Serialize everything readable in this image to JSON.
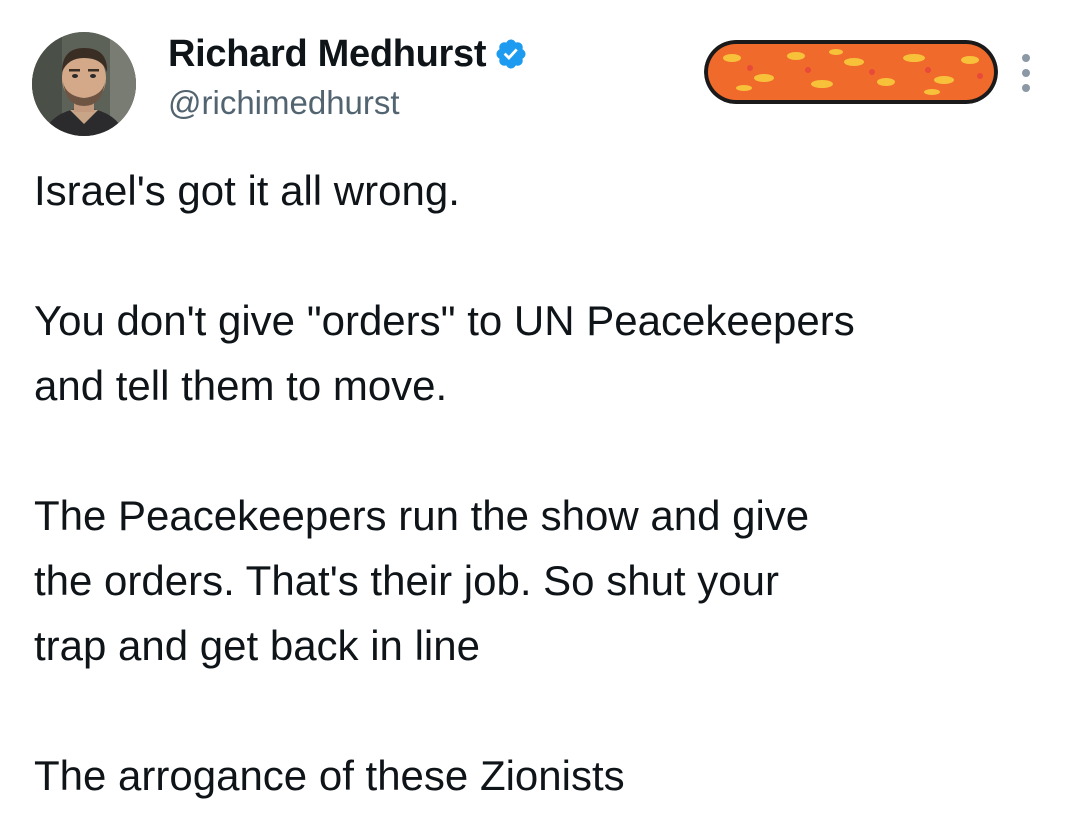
{
  "tweet": {
    "author": {
      "display_name": "Richard Medhurst",
      "handle": "@richimedhurst",
      "verified": true,
      "avatar_icon": "profile-photo"
    },
    "redacted_button_icon": "redacted-scribble",
    "more_icon": "vertical-ellipsis-icon",
    "paragraphs": [
      "Israel's got it all wrong.",
      "You don't give \"orders\" to UN Peacekeepers\nand tell them to move.",
      "The Peacekeepers run the show and give\nthe orders. That's their job. So shut your\ntrap and get back in line",
      "The arrogance of these Zionists"
    ]
  },
  "colors": {
    "verified_badge": "#1d9bf0",
    "handle_text": "#536471",
    "body_text": "#0f1419",
    "redaction_orange": "#f06a2c",
    "redaction_yellow": "#f7c23a"
  }
}
